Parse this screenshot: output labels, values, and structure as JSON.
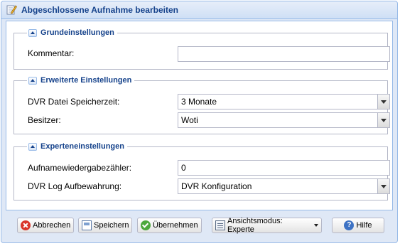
{
  "window": {
    "title": "Abgeschlossene Aufnahme bearbeiten"
  },
  "sections": {
    "basic": {
      "title": "Grundeinstellungen",
      "comment_label": "Kommentar:",
      "comment_value": ""
    },
    "advanced": {
      "title": "Erweiterte Einstellungen",
      "retention_label": "DVR Datei Speicherzeit:",
      "retention_value": "3 Monate",
      "owner_label": "Besitzer:",
      "owner_value": "Woti"
    },
    "expert": {
      "title": "Experteneinstellungen",
      "playcount_label": "Aufnamewiedergabezähler:",
      "playcount_value": "0",
      "log_label": "DVR Log Aufbewahrung:",
      "log_value": "DVR Konfiguration"
    }
  },
  "buttons": {
    "cancel": "Abbrechen",
    "save": "Speichern",
    "apply": "Übernehmen",
    "view_mode": "Ansichtsmodus: Experte",
    "help": "Hilfe"
  }
}
